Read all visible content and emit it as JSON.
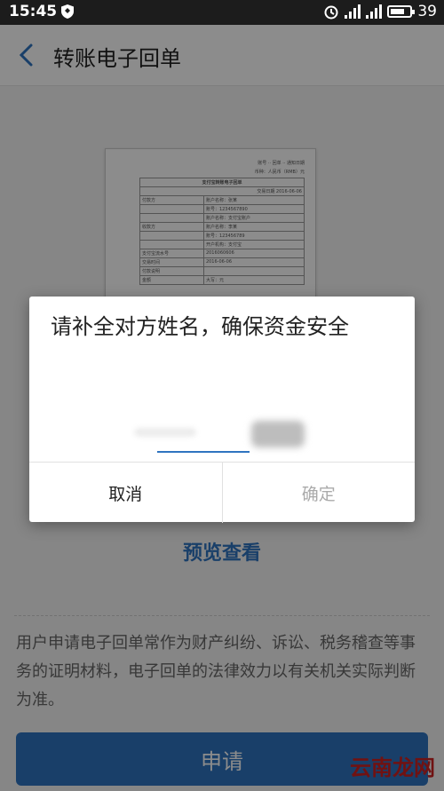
{
  "statusbar": {
    "time": "15:45",
    "battery": "39"
  },
  "header": {
    "title": "转账电子回单"
  },
  "receipt": {
    "top_right_1": "账号 ·· 回单 ·· 通知日期",
    "top_right_2": "币种：人民币（RMB）元",
    "title": "支付宝转账电子回单",
    "date_row": "交易日期 2016-06-06",
    "rows": [
      [
        "付款方",
        "账户名称：张某"
      ],
      [
        "",
        "账号：1234567890"
      ],
      [
        "",
        "账户名称：支付宝账户"
      ],
      [
        "收款方",
        "账户名称：李某"
      ],
      [
        "",
        "账号：123456789"
      ],
      [
        "",
        "开户机构：支付宝"
      ],
      [
        "支付宝流水号",
        "2016060606"
      ],
      [
        "交易时间",
        "2016-06-06"
      ],
      [
        "付款说明",
        ""
      ],
      [
        "金额",
        "大写：元"
      ]
    ]
  },
  "preview": {
    "label": "预览查看"
  },
  "disclaimer": {
    "text": "用户申请电子回单常作为财产纠纷、诉讼、税务稽查等事务的证明材料，电子回单的法律效力以有关机关实际判断为准。"
  },
  "apply": {
    "label": "申请"
  },
  "watermark": {
    "text": "云南龙网"
  },
  "dialog": {
    "message": "请补全对方姓名，确保资金安全",
    "input_value": "",
    "cancel_label": "取消",
    "confirm_label": "确定"
  },
  "colors": {
    "accent": "#2f74c0",
    "disabled": "#aaaaaa"
  }
}
